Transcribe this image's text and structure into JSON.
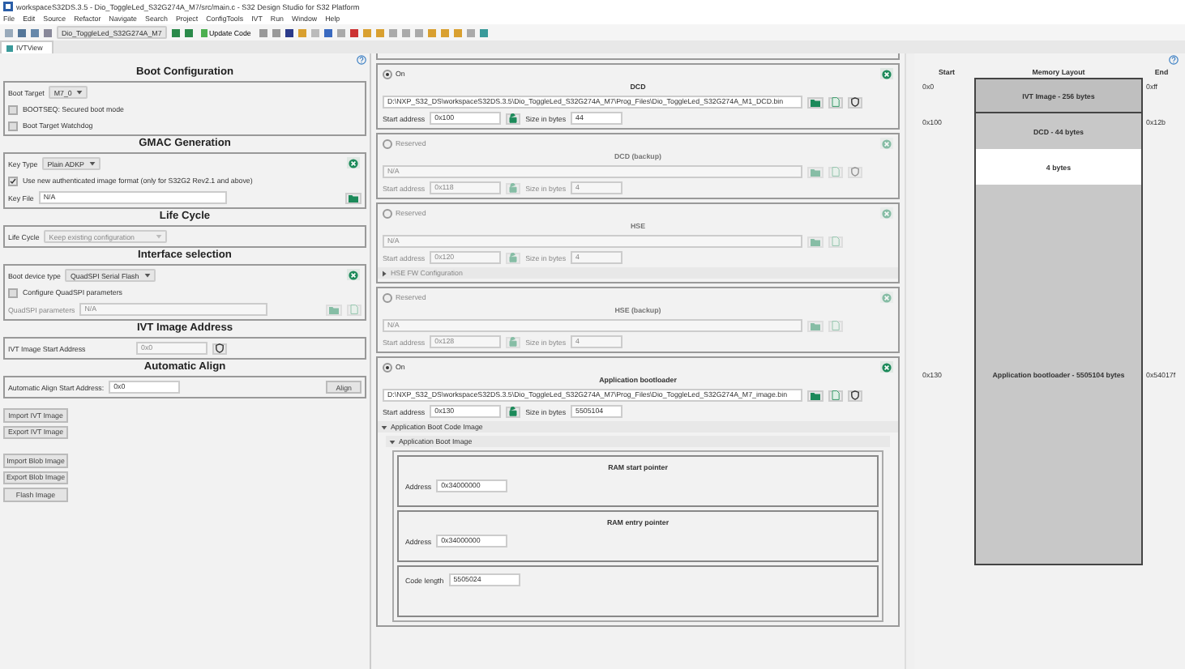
{
  "window": {
    "title": "workspaceS32DS.3.5 - Dio_ToggleLed_S32G274A_M7/src/main.c - S32 Design Studio for S32 Platform"
  },
  "menu": [
    "File",
    "Edit",
    "Source",
    "Refactor",
    "Navigate",
    "Search",
    "Project",
    "ConfigTools",
    "IVT",
    "Run",
    "Window",
    "Help"
  ],
  "toolbar": {
    "project": "Dio_ToggleLed_S32G274A_M7",
    "update_button": "Update Code"
  },
  "tab": {
    "label": "IVTView"
  },
  "left": {
    "sections": [
      {
        "title": "Boot Configuration",
        "clearable": false,
        "rows": [
          {
            "kind": "select",
            "label": "Boot Target",
            "value": "M7_0",
            "disabled": false
          },
          {
            "kind": "checkbox",
            "label": "BOOTSEQ: Secured boot mode",
            "checked": false
          },
          {
            "kind": "checkbox",
            "label": "Boot Target Watchdog",
            "checked": false
          }
        ]
      },
      {
        "title": "GMAC Generation",
        "clearable": true,
        "rows": [
          {
            "kind": "select",
            "label": "Key Type",
            "value": "Plain ADKP",
            "disabled": false
          },
          {
            "kind": "checkbox",
            "label": "Use new authenticated image format (only for S32G2 Rev2.1 and above)",
            "checked": true
          },
          {
            "kind": "file",
            "label": "Key File",
            "value": "N/A",
            "disabled": false
          }
        ]
      },
      {
        "title": "Life Cycle",
        "clearable": false,
        "rows": [
          {
            "kind": "select",
            "label": "Life Cycle",
            "value": "Keep existing configuration",
            "disabled": true
          }
        ]
      },
      {
        "title": "Interface selection",
        "clearable": true,
        "rows": [
          {
            "kind": "select",
            "label": "Boot device type",
            "value": "QuadSPI Serial Flash",
            "disabled": false
          },
          {
            "kind": "checkbox",
            "label": "Configure QuadSPI parameters",
            "checked": false
          },
          {
            "kind": "params",
            "label": "QuadSPI parameters",
            "value": "N/A",
            "disabled": true
          }
        ]
      },
      {
        "title": "IVT Image Address",
        "clearable": false,
        "rows": [
          {
            "kind": "address",
            "label": "IVT Image Start Address",
            "value": "0x0",
            "disabled": true
          }
        ]
      },
      {
        "title": "Automatic Align",
        "clearable": false,
        "rows": [
          {
            "kind": "align",
            "label": "Automatic Align Start Address:",
            "value": "0x0",
            "button": "Align"
          }
        ]
      }
    ],
    "button_groups": [
      [
        "Import IVT Image",
        "Export IVT Image"
      ],
      [
        "Import Blob Image",
        "Export Blob Image",
        "Flash Image"
      ]
    ]
  },
  "images": [
    {
      "title": "DCD",
      "kind": "signed",
      "radio": {
        "label": "On",
        "selected": true
      },
      "path": "D:\\NXP_S32_DS\\workspaceS32DS.3.5\\Dio_ToggleLed_S32G274A_M7\\Prog_Files\\Dio_ToggleLed_S32G274A_M1_DCD.bin",
      "start_label": "Start address",
      "start": "0x100",
      "size_label": "Size in bytes",
      "size": "44"
    },
    {
      "title": "DCD (backup)",
      "kind": "signed",
      "radio": {
        "label": "Reserved",
        "selected": false
      },
      "path": "N/A",
      "start_label": "Start address",
      "start": "0x118",
      "size_label": "Size in bytes",
      "size": "4"
    },
    {
      "title": "HSE",
      "kind": "plain",
      "radio": {
        "label": "Reserved",
        "selected": false
      },
      "path": "N/A",
      "start_label": "Start address",
      "start": "0x120",
      "size_label": "Size in bytes",
      "size": "4",
      "expanders": [
        {
          "label": "HSE FW Configuration",
          "expanded": false
        }
      ]
    },
    {
      "title": "HSE (backup)",
      "kind": "plain",
      "radio": {
        "label": "Reserved",
        "selected": false
      },
      "path": "N/A",
      "start_label": "Start address",
      "start": "0x128",
      "size_label": "Size in bytes",
      "size": "4"
    },
    {
      "title": "Application bootloader",
      "kind": "signed",
      "radio": {
        "label": "On",
        "selected": true
      },
      "path": "D:\\NXP_S32_DS\\workspaceS32DS.3.5\\Dio_ToggleLed_S32G274A_M7\\Prog_Files\\Dio_ToggleLed_S32G274A_M7_image.bin",
      "start_label": "Start address",
      "start": "0x130",
      "size_label": "Size in bytes",
      "size": "5505104",
      "expanders": [
        {
          "label": "Application Boot Code Image",
          "expanded": true,
          "children": [
            {
              "label": "Application Boot Image",
              "expanded": true,
              "groups": [
                {
                  "title": "RAM start pointer",
                  "field_label": "Address",
                  "value": "0x34000000"
                },
                {
                  "title": "RAM entry pointer",
                  "field_label": "Address",
                  "value": "0x34000000"
                },
                {
                  "field_label": "Code length",
                  "value": "5505024"
                }
              ]
            }
          ]
        }
      ]
    }
  ],
  "memory": {
    "headers": [
      "Start",
      "Memory Layout",
      "End"
    ],
    "blocks": [
      {
        "kind": "image",
        "label": "IVT Image - 256 bytes",
        "start": "0x0",
        "end": "0xff"
      },
      {
        "kind": "region",
        "label": "DCD - 44 bytes",
        "start": "0x100",
        "end": "0x12b"
      },
      {
        "kind": "free",
        "label": "4 bytes"
      },
      {
        "kind": "large",
        "label": "Application bootloader - 5505104 bytes",
        "start": "0x130",
        "end": "0x54017f"
      }
    ]
  }
}
